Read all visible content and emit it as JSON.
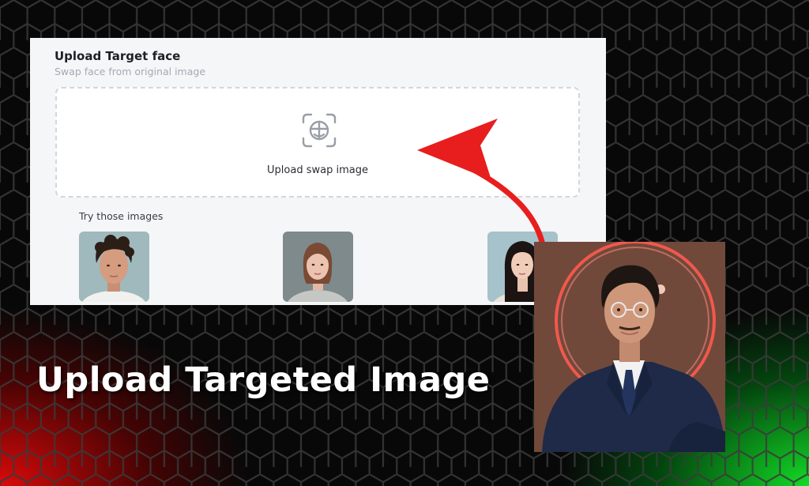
{
  "panel": {
    "title": "Upload Target face",
    "subtitle": "Swap face from original image",
    "dropzone_label": "Upload swap image",
    "samples_label": "Try those images",
    "samples": [
      {
        "icon": "curly-hair-man-photo"
      },
      {
        "icon": "woman-photo"
      },
      {
        "icon": "asian-woman-photo"
      }
    ]
  },
  "headline": "Upload Targeted Image",
  "colors": {
    "arrow": "#e81e1e",
    "left_glow": "#e60a0a",
    "right_glow": "#14e628",
    "panel_bg": "#f5f6f8"
  }
}
